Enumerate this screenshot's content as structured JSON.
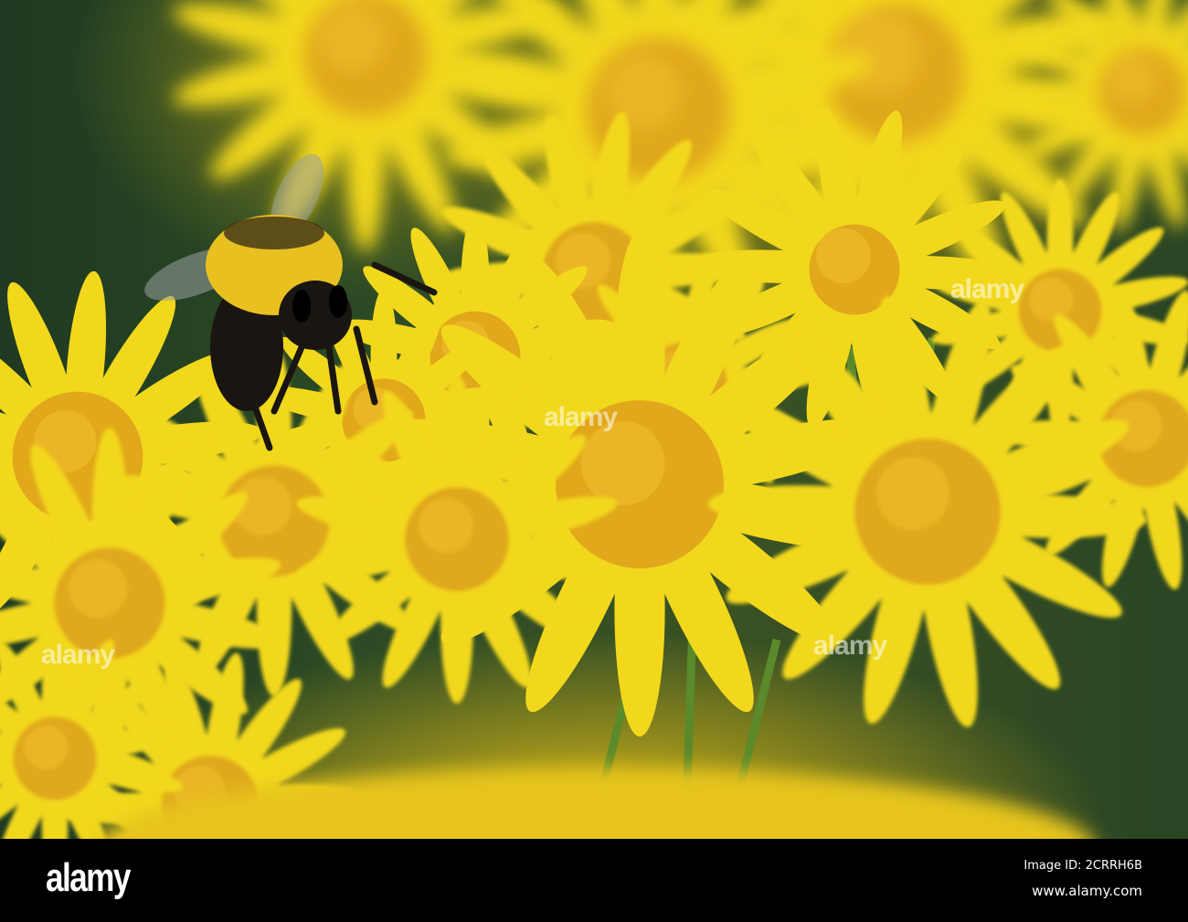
{
  "photo": {
    "subject": "bumblebee-on-yellow-ragwort-flowers",
    "colors": {
      "petal": "#f2d81c",
      "center": "#e0a81a",
      "bee": "#1a1510",
      "fur": "#e8c020",
      "stem": "#5a8a2a"
    }
  },
  "watermark": {
    "text": "alamy"
  },
  "footer": {
    "logo": "alamy",
    "image_id": "Image ID: 2CRRH6B",
    "website": "www.alamy.com"
  }
}
